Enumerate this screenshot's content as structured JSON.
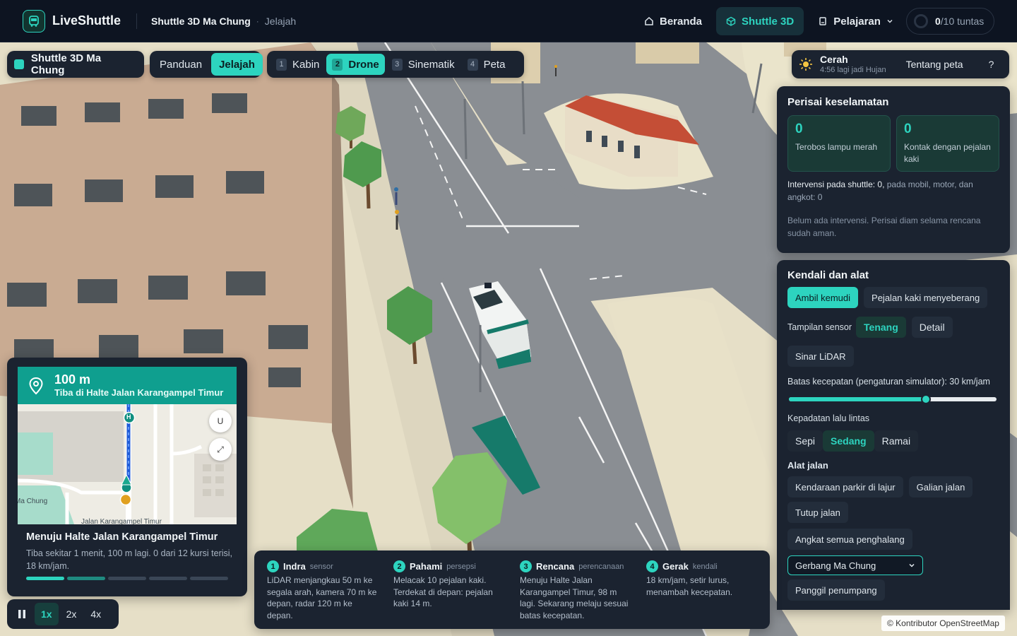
{
  "app": {
    "name": "LiveShuttle"
  },
  "breadcrumb": {
    "title": "Shuttle 3D Ma Chung",
    "separator": "·",
    "mode": "Jelajah"
  },
  "topnav": {
    "items": [
      {
        "label": "Beranda",
        "icon": "home-icon"
      },
      {
        "label": "Shuttle 3D",
        "icon": "cube-icon",
        "active": true
      },
      {
        "label": "Pelajaran",
        "icon": "book-icon"
      }
    ],
    "progress": {
      "done": "0",
      "total": "/10 tuntas"
    }
  },
  "scene_bar": {
    "title": "Shuttle 3D Ma Chung",
    "modes": [
      "Panduan",
      "Jelajah"
    ],
    "active_mode": "Jelajah",
    "cameras": [
      {
        "key": "1",
        "label": "Kabin"
      },
      {
        "key": "2",
        "label": "Drone"
      },
      {
        "key": "3",
        "label": "Sinematik"
      },
      {
        "key": "4",
        "label": "Peta"
      }
    ],
    "active_camera": "Drone"
  },
  "weather": {
    "title": "Cerah",
    "subtitle": "4:56 lagi jadi Hujan",
    "about": "Tentang peta",
    "help": "?"
  },
  "safety": {
    "title": "Perisai keselamatan",
    "stats": [
      {
        "value": "0",
        "label": "Terobos lampu merah"
      },
      {
        "value": "0",
        "label": "Kontak dengan pejalan kaki"
      }
    ],
    "interventions_label": "Intervensi pada shuttle: 0,",
    "interventions_rest": " pada mobil, motor, dan angkot: 0",
    "note": "Belum ada intervensi. Perisai diam selama rencana sudah aman."
  },
  "controls": {
    "title": "Kendali dan alat",
    "take_control": "Ambil kemudi",
    "pedestrian": "Pejalan kaki menyeberang",
    "sensor_label": "Tampilan sensor",
    "sensor_options": [
      "Tenang",
      "Detail"
    ],
    "sensor_active": "Tenang",
    "lidar": "Sinar LiDAR",
    "speed_label": "Batas kecepatan (pengaturan simulator): 30 km/jam",
    "speed_fraction": 0.66,
    "traffic_label": "Kepadatan lalu lintas",
    "traffic_options": [
      "Sepi",
      "Sedang",
      "Ramai"
    ],
    "traffic_active": "Sedang",
    "tools_label": "Alat jalan",
    "tools": [
      "Kendaraan parkir di lajur",
      "Galian jalan",
      "Tutup jalan",
      "Angkat semua penghalang"
    ],
    "gate_select": "Gerbang Ma Chung",
    "call_passenger": "Panggil penumpang"
  },
  "navigation": {
    "distance": "100 m",
    "destination": "Tiba di Halte Jalan Karangampel Timur",
    "title": "Menuju Halte Jalan Karangampel Timur",
    "description": "Tiba sekitar 1 menit, 100 m lagi. 0 dari 12 kursi terisi, 18 km/jam.",
    "map_labels": {
      "place": "Ma Chung",
      "street": "Jalan Karangampel Timur",
      "stop_badge": "H"
    },
    "map_buttons": {
      "north": "U",
      "expand": "⤢"
    }
  },
  "playback": {
    "speeds": [
      "1x",
      "2x",
      "4x"
    ],
    "active": "1x"
  },
  "pipeline": [
    {
      "n": "1",
      "name": "Indra",
      "tag": "sensor",
      "text": "LiDAR menjangkau 50 m ke segala arah, kamera 70 m ke depan, radar 120 m ke depan."
    },
    {
      "n": "2",
      "name": "Pahami",
      "tag": "persepsi",
      "text": "Melacak 10 pejalan kaki. Terdekat di depan: pejalan kaki 14 m."
    },
    {
      "n": "3",
      "name": "Rencana",
      "tag": "perencanaan",
      "text": "Menuju Halte Jalan Karangampel Timur, 98 m lagi. Sekarang melaju sesuai batas kecepatan."
    },
    {
      "n": "4",
      "name": "Gerak",
      "tag": "kendali",
      "text": "18 km/jam, setir lurus, menambah kecepatan."
    }
  ],
  "attribution": "© Kontributor OpenStreetMap",
  "colors": {
    "accent": "#2dd4bf",
    "panel": "#1b2330",
    "topbar": "#0d1421",
    "nav_header": "#0f9f8f",
    "route": "#1f5bd8"
  }
}
